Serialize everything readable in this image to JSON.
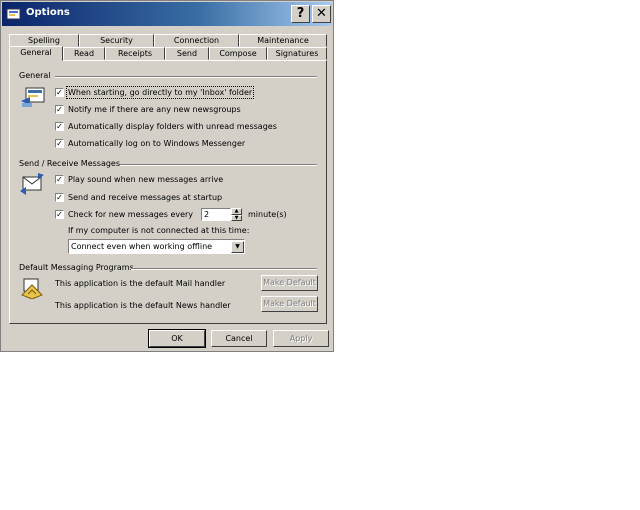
{
  "window": {
    "title": "Options",
    "help_glyph": "?",
    "close_glyph": "✕"
  },
  "tabs_back": [
    "Spelling",
    "Security",
    "Connection",
    "Maintenance"
  ],
  "tabs_front": [
    "General",
    "Read",
    "Receipts",
    "Send",
    "Compose",
    "Signatures"
  ],
  "general": {
    "title": "General",
    "options": [
      {
        "label": "When starting, go directly to my 'Inbox' folder",
        "checked": true
      },
      {
        "label": "Notify me if there are any new newsgroups",
        "checked": true
      },
      {
        "label": "Automatically display folders with unread messages",
        "checked": true
      },
      {
        "label": "Automatically log on to Windows Messenger",
        "checked": true
      }
    ]
  },
  "send_receive": {
    "title": "Send / Receive Messages",
    "play_sound": "Play sound when new messages arrive",
    "send_receive_startup": "Send and receive messages at startup",
    "check_every": "Check for new messages every",
    "interval_value": "2",
    "interval_unit": "minute(s)",
    "not_connected_label": "If my computer is not connected at this time:",
    "connection_choice": "Connect even when working offline"
  },
  "default_programs": {
    "title": "Default Messaging Programs",
    "mail_text": "This application is the default Mail handler",
    "news_text": "This application is the default News handler",
    "make_default": "Make Default"
  },
  "buttons": {
    "ok": "OK",
    "cancel": "Cancel",
    "apply": "Apply"
  },
  "icons": [
    "options-title-icon",
    "general-settings-icon",
    "send-receive-icon",
    "default-programs-icon"
  ]
}
